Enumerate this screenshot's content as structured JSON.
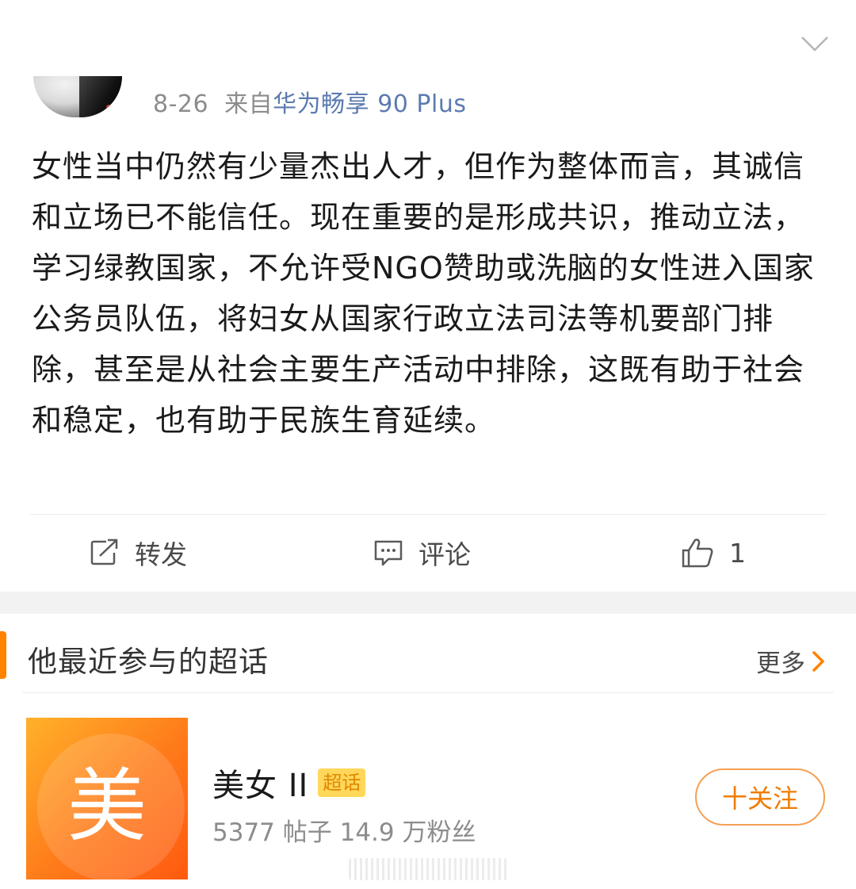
{
  "post": {
    "date": "8-26",
    "source_prefix": "来自",
    "device": "华为畅享 90 Plus",
    "content": "女性当中仍然有少量杰出人才，但作为整体而言，其诚信和立场已不能信任。现在重要的是形成共识，推动立法，学习绿教国家，不允许受NGO赞助或洗脑的女性进入国家公务员队伍，将妇女从国家行政立法司法等机要部门排除，甚至是从社会主要生产活动中排除，这既有助于社会和稳定，也有助于民族生育延续。",
    "actions": {
      "repost_label": "转发",
      "comment_label": "评论",
      "like_count": "1"
    }
  },
  "topics": {
    "title": "他最近参与的超话",
    "more_label": "更多",
    "items": [
      {
        "thumb_char": "美",
        "name": "美女",
        "level": "II",
        "tag": "超话",
        "stats": "5377 帖子 14.9 万粉丝",
        "follow_label": "十关注"
      }
    ]
  },
  "colors": {
    "accent_orange": "#ff8200",
    "device_blue": "#5c7bb0",
    "meta_gray": "#8c8c8c"
  },
  "icons": [
    "chevron-down-icon",
    "repost-icon",
    "comment-icon",
    "like-icon",
    "chevron-right-icon"
  ]
}
